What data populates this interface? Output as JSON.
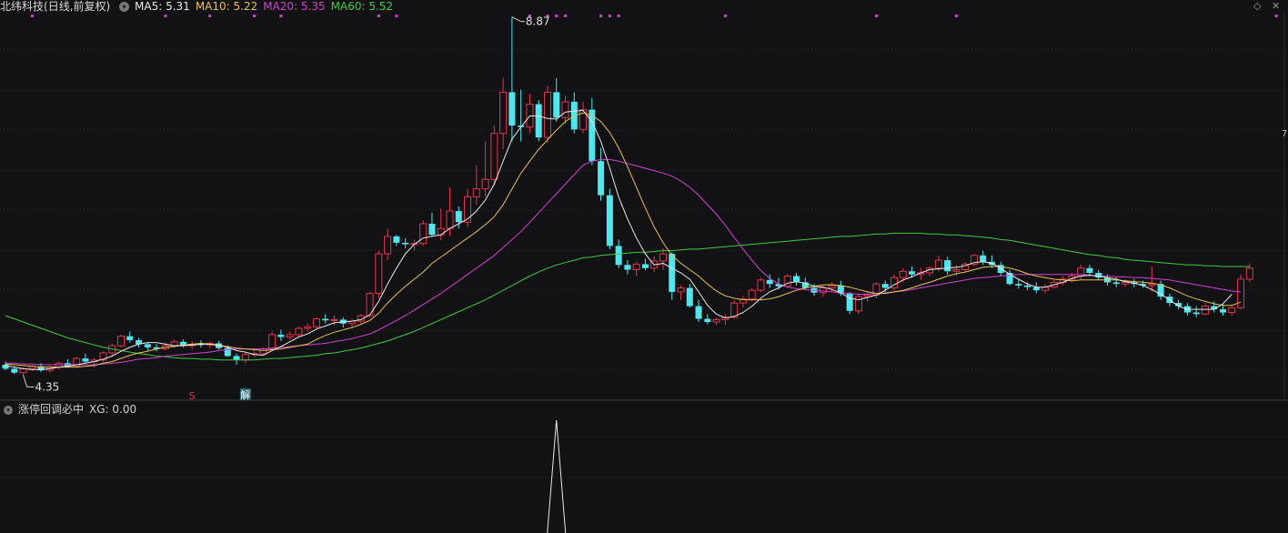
{
  "main_header": {
    "stock_name": "北纬科技",
    "period": "(日线,前复权)",
    "toggle_glyph": "▾",
    "ma": [
      {
        "label": "MA5: 5.31",
        "color": "#e8e8e8"
      },
      {
        "label": "MA10: 5.22",
        "color": "#e8c24a"
      },
      {
        "label": "MA20: 5.35",
        "color": "#d43fd4"
      },
      {
        "label": "MA60: 5.52",
        "color": "#3ecb3e"
      }
    ]
  },
  "sub_header": {
    "indicator": "涨停回调必中",
    "value": "XG: 0.00",
    "toggle_glyph": "▾"
  },
  "annotations": {
    "high_label": "8.87",
    "low_label": "4.35",
    "marker_s": "S",
    "marker_jie": "解",
    "edge_mark": "7"
  },
  "icons": {
    "diamond": "◇",
    "close": "✕"
  },
  "colors": {
    "bg": "#121215",
    "up": "#e8334a",
    "down": "#4ce8f0",
    "grid": "#2a2a30",
    "divider": "#3a3a40",
    "ma5": "#e8e8e8",
    "ma10": "#e8c24a",
    "ma20": "#d43fd4",
    "ma60": "#3ecb3e",
    "signal": "#d43fd4",
    "xg": "#e8e8e8"
  },
  "chart_data": {
    "type": "candlestick",
    "ohlc": [
      [
        4.48,
        4.52,
        4.41,
        4.43
      ],
      [
        4.43,
        4.46,
        4.36,
        4.38
      ],
      [
        4.38,
        4.45,
        4.35,
        4.43
      ],
      [
        4.43,
        4.48,
        4.4,
        4.46
      ],
      [
        4.46,
        4.5,
        4.39,
        4.41
      ],
      [
        4.41,
        4.47,
        4.38,
        4.45
      ],
      [
        4.45,
        4.52,
        4.42,
        4.5
      ],
      [
        4.5,
        4.55,
        4.44,
        4.46
      ],
      [
        4.46,
        4.58,
        4.44,
        4.56
      ],
      [
        4.56,
        4.62,
        4.5,
        4.52
      ],
      [
        4.52,
        4.56,
        4.45,
        4.54
      ],
      [
        4.54,
        4.65,
        4.52,
        4.63
      ],
      [
        4.63,
        4.75,
        4.6,
        4.72
      ],
      [
        4.72,
        4.86,
        4.7,
        4.84
      ],
      [
        4.84,
        4.9,
        4.76,
        4.79
      ],
      [
        4.79,
        4.82,
        4.7,
        4.74
      ],
      [
        4.74,
        4.76,
        4.66,
        4.7
      ],
      [
        4.7,
        4.74,
        4.65,
        4.68
      ],
      [
        4.68,
        4.76,
        4.66,
        4.72
      ],
      [
        4.72,
        4.8,
        4.7,
        4.77
      ],
      [
        4.77,
        4.8,
        4.7,
        4.72
      ],
      [
        4.72,
        4.78,
        4.68,
        4.74
      ],
      [
        4.74,
        4.79,
        4.7,
        4.73
      ],
      [
        4.73,
        4.77,
        4.69,
        4.75
      ],
      [
        4.75,
        4.78,
        4.67,
        4.69
      ],
      [
        4.69,
        4.72,
        4.58,
        4.59
      ],
      [
        4.59,
        4.62,
        4.48,
        4.54
      ],
      [
        4.54,
        4.63,
        4.5,
        4.61
      ],
      [
        4.61,
        4.66,
        4.58,
        4.62
      ],
      [
        4.62,
        4.7,
        4.6,
        4.68
      ],
      [
        4.68,
        4.9,
        4.66,
        4.86
      ],
      [
        4.86,
        4.92,
        4.78,
        4.83
      ],
      [
        4.83,
        4.9,
        4.8,
        4.86
      ],
      [
        4.86,
        4.96,
        4.84,
        4.94
      ],
      [
        4.94,
        5.0,
        4.9,
        4.96
      ],
      [
        4.96,
        5.08,
        4.94,
        5.06
      ],
      [
        5.06,
        5.12,
        5.0,
        5.04
      ],
      [
        5.04,
        5.1,
        4.98,
        5.05
      ],
      [
        5.05,
        5.08,
        4.95,
        5.0
      ],
      [
        5.0,
        5.06,
        4.96,
        5.03
      ],
      [
        5.03,
        5.12,
        5.0,
        5.1
      ],
      [
        5.1,
        5.4,
        5.08,
        5.38
      ],
      [
        5.38,
        5.92,
        5.32,
        5.88
      ],
      [
        5.88,
        6.2,
        5.8,
        6.1
      ],
      [
        6.1,
        6.12,
        5.98,
        6.02
      ],
      [
        6.02,
        6.08,
        5.95,
        6.0
      ],
      [
        6.0,
        6.06,
        5.92,
        6.01
      ],
      [
        6.01,
        6.3,
        5.98,
        6.26
      ],
      [
        6.26,
        6.4,
        6.1,
        6.12
      ],
      [
        6.12,
        6.45,
        6.05,
        6.2
      ],
      [
        6.2,
        6.72,
        6.1,
        6.42
      ],
      [
        6.42,
        6.48,
        6.2,
        6.28
      ],
      [
        6.28,
        6.7,
        6.22,
        6.6
      ],
      [
        6.6,
        7.0,
        6.5,
        6.7
      ],
      [
        6.7,
        7.3,
        6.6,
        6.82
      ],
      [
        6.82,
        7.5,
        6.75,
        7.4
      ],
      [
        7.4,
        8.1,
        7.2,
        7.92
      ],
      [
        7.92,
        8.87,
        7.3,
        7.5
      ],
      [
        7.5,
        7.95,
        7.3,
        7.48
      ],
      [
        7.48,
        7.9,
        7.4,
        7.77
      ],
      [
        7.77,
        7.82,
        7.3,
        7.35
      ],
      [
        7.35,
        8.0,
        7.28,
        7.92
      ],
      [
        7.92,
        8.1,
        7.55,
        7.6
      ],
      [
        7.6,
        7.88,
        7.52,
        7.8
      ],
      [
        7.8,
        7.92,
        7.4,
        7.45
      ],
      [
        7.45,
        7.8,
        7.4,
        7.7
      ],
      [
        7.7,
        7.85,
        7.0,
        7.05
      ],
      [
        7.05,
        7.22,
        6.55,
        6.62
      ],
      [
        6.62,
        6.7,
        5.94,
        5.98
      ],
      [
        5.98,
        6.06,
        5.7,
        5.74
      ],
      [
        5.74,
        5.8,
        5.62,
        5.68
      ],
      [
        5.68,
        5.78,
        5.6,
        5.75
      ],
      [
        5.75,
        5.82,
        5.67,
        5.7
      ],
      [
        5.7,
        5.85,
        5.65,
        5.79
      ],
      [
        5.79,
        5.95,
        5.68,
        5.88
      ],
      [
        5.88,
        5.9,
        5.3,
        5.4
      ],
      [
        5.4,
        5.48,
        5.3,
        5.45
      ],
      [
        5.45,
        5.5,
        5.2,
        5.22
      ],
      [
        5.22,
        5.3,
        5.02,
        5.06
      ],
      [
        5.06,
        5.12,
        4.99,
        5.02
      ],
      [
        5.02,
        5.07,
        4.98,
        5.05
      ],
      [
        5.05,
        5.12,
        4.98,
        5.08
      ],
      [
        5.08,
        5.3,
        5.06,
        5.26
      ],
      [
        5.26,
        5.35,
        5.2,
        5.31
      ],
      [
        5.31,
        5.45,
        5.28,
        5.42
      ],
      [
        5.42,
        5.58,
        5.4,
        5.55
      ],
      [
        5.55,
        5.62,
        5.45,
        5.5
      ],
      [
        5.5,
        5.58,
        5.43,
        5.47
      ],
      [
        5.47,
        5.62,
        5.45,
        5.6
      ],
      [
        5.6,
        5.64,
        5.48,
        5.52
      ],
      [
        5.52,
        5.58,
        5.42,
        5.45
      ],
      [
        5.45,
        5.5,
        5.35,
        5.39
      ],
      [
        5.39,
        5.48,
        5.34,
        5.45
      ],
      [
        5.45,
        5.52,
        5.4,
        5.48
      ],
      [
        5.48,
        5.54,
        5.35,
        5.38
      ],
      [
        5.38,
        5.4,
        5.12,
        5.16
      ],
      [
        5.16,
        5.38,
        5.12,
        5.34
      ],
      [
        5.34,
        5.4,
        5.28,
        5.36
      ],
      [
        5.36,
        5.52,
        5.32,
        5.5
      ],
      [
        5.5,
        5.54,
        5.4,
        5.45
      ],
      [
        5.45,
        5.62,
        5.42,
        5.58
      ],
      [
        5.58,
        5.7,
        5.52,
        5.66
      ],
      [
        5.66,
        5.72,
        5.58,
        5.62
      ],
      [
        5.62,
        5.7,
        5.55,
        5.64
      ],
      [
        5.64,
        5.72,
        5.6,
        5.7
      ],
      [
        5.7,
        5.86,
        5.66,
        5.8
      ],
      [
        5.8,
        5.84,
        5.62,
        5.66
      ],
      [
        5.66,
        5.74,
        5.6,
        5.68
      ],
      [
        5.68,
        5.78,
        5.65,
        5.75
      ],
      [
        5.75,
        5.88,
        5.72,
        5.86
      ],
      [
        5.86,
        5.92,
        5.74,
        5.78
      ],
      [
        5.78,
        5.86,
        5.7,
        5.74
      ],
      [
        5.74,
        5.78,
        5.6,
        5.64
      ],
      [
        5.64,
        5.68,
        5.48,
        5.5
      ],
      [
        5.5,
        5.56,
        5.44,
        5.48
      ],
      [
        5.48,
        5.52,
        5.42,
        5.46
      ],
      [
        5.46,
        5.52,
        5.38,
        5.42
      ],
      [
        5.42,
        5.5,
        5.38,
        5.46
      ],
      [
        5.46,
        5.56,
        5.44,
        5.52
      ],
      [
        5.52,
        5.6,
        5.48,
        5.56
      ],
      [
        5.56,
        5.64,
        5.52,
        5.6
      ],
      [
        5.6,
        5.74,
        5.56,
        5.7
      ],
      [
        5.7,
        5.74,
        5.6,
        5.64
      ],
      [
        5.64,
        5.68,
        5.55,
        5.58
      ],
      [
        5.58,
        5.62,
        5.48,
        5.52
      ],
      [
        5.52,
        5.58,
        5.46,
        5.5
      ],
      [
        5.5,
        5.56,
        5.46,
        5.52
      ],
      [
        5.52,
        5.56,
        5.46,
        5.5
      ],
      [
        5.5,
        5.54,
        5.45,
        5.48
      ],
      [
        5.48,
        5.72,
        5.4,
        5.5
      ],
      [
        5.5,
        5.54,
        5.3,
        5.34
      ],
      [
        5.34,
        5.38,
        5.22,
        5.26
      ],
      [
        5.26,
        5.3,
        5.18,
        5.22
      ],
      [
        5.22,
        5.26,
        5.1,
        5.14
      ],
      [
        5.14,
        5.22,
        5.08,
        5.12
      ],
      [
        5.12,
        5.26,
        5.1,
        5.22
      ],
      [
        5.22,
        5.28,
        5.14,
        5.18
      ],
      [
        5.18,
        5.24,
        5.1,
        5.14
      ],
      [
        5.14,
        5.22,
        5.1,
        5.2
      ],
      [
        5.2,
        5.62,
        5.18,
        5.56
      ],
      [
        5.56,
        5.76,
        5.52,
        5.7
      ]
    ],
    "ma5": [
      4.47,
      4.45,
      4.43,
      4.42,
      4.42,
      4.43,
      4.45,
      4.46,
      4.48,
      4.5,
      4.52,
      4.55,
      4.59,
      4.65,
      4.7,
      4.74,
      4.76,
      4.76,
      4.74,
      4.72,
      4.72,
      4.73,
      4.74,
      4.74,
      4.73,
      4.7,
      4.66,
      4.64,
      4.61,
      4.6,
      4.66,
      4.71,
      4.77,
      4.83,
      4.87,
      4.93,
      4.97,
      5.01,
      5.02,
      5.03,
      5.05,
      5.11,
      5.28,
      5.5,
      5.7,
      5.88,
      6.0,
      6.08,
      6.1,
      6.12,
      6.2,
      6.26,
      6.32,
      6.42,
      6.56,
      6.76,
      7.05,
      7.33,
      7.48,
      7.62,
      7.62,
      7.59,
      7.58,
      7.67,
      7.68,
      7.69,
      7.55,
      7.3,
      6.96,
      6.6,
      6.32,
      6.08,
      5.88,
      5.74,
      5.76,
      5.7,
      5.64,
      5.56,
      5.4,
      5.23,
      5.12,
      5.07,
      5.09,
      5.14,
      5.22,
      5.32,
      5.4,
      5.45,
      5.51,
      5.53,
      5.51,
      5.47,
      5.46,
      5.43,
      5.39,
      5.32,
      5.3,
      5.33,
      5.36,
      5.42,
      5.49,
      5.55,
      5.59,
      5.64,
      5.68,
      5.69,
      5.7,
      5.71,
      5.73,
      5.77,
      5.78,
      5.76,
      5.7,
      5.62,
      5.56,
      5.5,
      5.46,
      5.46,
      5.49,
      5.52,
      5.57,
      5.6,
      5.61,
      5.6,
      5.58,
      5.56,
      5.53,
      5.51,
      5.48,
      5.43,
      5.37,
      5.3,
      5.22,
      5.18,
      5.18,
      5.18,
      5.18,
      5.25,
      5.37
    ],
    "ma10": [
      4.49,
      4.48,
      4.47,
      4.46,
      4.45,
      4.45,
      4.45,
      4.45,
      4.45,
      4.46,
      4.47,
      4.5,
      4.52,
      4.56,
      4.6,
      4.63,
      4.65,
      4.68,
      4.7,
      4.71,
      4.73,
      4.74,
      4.75,
      4.74,
      4.72,
      4.71,
      4.69,
      4.68,
      4.67,
      4.66,
      4.67,
      4.68,
      4.7,
      4.72,
      4.74,
      4.8,
      4.85,
      4.89,
      4.92,
      4.95,
      4.99,
      5.04,
      5.13,
      5.26,
      5.37,
      5.47,
      5.56,
      5.65,
      5.76,
      5.84,
      5.92,
      6.0,
      6.08,
      6.16,
      6.25,
      6.35,
      6.5,
      6.7,
      6.9,
      7.05,
      7.2,
      7.32,
      7.44,
      7.55,
      7.62,
      7.66,
      7.63,
      7.55,
      7.41,
      7.22,
      6.98,
      6.72,
      6.46,
      6.22,
      6.02,
      5.86,
      5.76,
      5.68,
      5.6,
      5.5,
      5.41,
      5.35,
      5.32,
      5.3,
      5.3,
      5.3,
      5.31,
      5.34,
      5.38,
      5.42,
      5.45,
      5.47,
      5.49,
      5.49,
      5.48,
      5.46,
      5.43,
      5.4,
      5.38,
      5.38,
      5.4,
      5.42,
      5.45,
      5.49,
      5.52,
      5.56,
      5.6,
      5.63,
      5.65,
      5.68,
      5.71,
      5.72,
      5.72,
      5.7,
      5.67,
      5.63,
      5.6,
      5.58,
      5.56,
      5.55,
      5.54,
      5.55,
      5.55,
      5.55,
      5.55,
      5.55,
      5.54,
      5.53,
      5.52,
      5.51,
      5.49,
      5.45,
      5.4,
      5.35,
      5.31,
      5.28,
      5.25,
      5.23,
      5.23,
      5.27
    ],
    "ma20": [
      4.5,
      4.5,
      4.49,
      4.49,
      4.48,
      4.48,
      4.48,
      4.48,
      4.48,
      4.48,
      4.48,
      4.49,
      4.5,
      4.51,
      4.53,
      4.55,
      4.56,
      4.57,
      4.59,
      4.6,
      4.61,
      4.62,
      4.63,
      4.64,
      4.66,
      4.67,
      4.68,
      4.68,
      4.68,
      4.68,
      4.69,
      4.7,
      4.71,
      4.72,
      4.73,
      4.74,
      4.75,
      4.77,
      4.79,
      4.81,
      4.84,
      4.87,
      4.92,
      4.98,
      5.04,
      5.1,
      5.17,
      5.24,
      5.31,
      5.38,
      5.46,
      5.54,
      5.62,
      5.7,
      5.78,
      5.86,
      5.96,
      6.06,
      6.16,
      6.28,
      6.4,
      6.52,
      6.64,
      6.76,
      6.88,
      7.0,
      7.05,
      7.07,
      7.07,
      7.05,
      7.02,
      6.99,
      6.96,
      6.93,
      6.9,
      6.86,
      6.8,
      6.72,
      6.62,
      6.5,
      6.38,
      6.24,
      6.09,
      5.94,
      5.8,
      5.67,
      5.57,
      5.5,
      5.46,
      5.44,
      5.43,
      5.42,
      5.41,
      5.4,
      5.39,
      5.38,
      5.37,
      5.37,
      5.38,
      5.39,
      5.4,
      5.41,
      5.43,
      5.45,
      5.47,
      5.49,
      5.51,
      5.53,
      5.55,
      5.57,
      5.58,
      5.59,
      5.6,
      5.61,
      5.62,
      5.62,
      5.62,
      5.62,
      5.62,
      5.62,
      5.62,
      5.62,
      5.61,
      5.6,
      5.6,
      5.59,
      5.59,
      5.58,
      5.58,
      5.57,
      5.56,
      5.55,
      5.53,
      5.51,
      5.49,
      5.47,
      5.45,
      5.43,
      5.41,
      5.4
    ],
    "ma60": [
      5.1,
      5.06,
      5.02,
      4.98,
      4.94,
      4.9,
      4.86,
      4.82,
      4.79,
      4.76,
      4.73,
      4.7,
      4.68,
      4.66,
      4.64,
      4.62,
      4.61,
      4.59,
      4.58,
      4.57,
      4.56,
      4.56,
      4.55,
      4.55,
      4.54,
      4.54,
      4.54,
      4.54,
      4.54,
      4.55,
      4.56,
      4.56,
      4.57,
      4.58,
      4.59,
      4.6,
      4.62,
      4.63,
      4.65,
      4.67,
      4.69,
      4.72,
      4.75,
      4.78,
      4.82,
      4.86,
      4.9,
      4.95,
      5.0,
      5.05,
      5.1,
      5.15,
      5.2,
      5.25,
      5.3,
      5.36,
      5.42,
      5.48,
      5.54,
      5.6,
      5.65,
      5.7,
      5.74,
      5.77,
      5.8,
      5.83,
      5.84,
      5.86,
      5.87,
      5.88,
      5.89,
      5.9,
      5.9,
      5.91,
      5.92,
      5.92,
      5.93,
      5.94,
      5.94,
      5.95,
      5.96,
      5.97,
      5.98,
      5.99,
      6.0,
      6.01,
      6.02,
      6.03,
      6.04,
      6.05,
      6.06,
      6.07,
      6.08,
      6.09,
      6.1,
      6.1,
      6.11,
      6.12,
      6.13,
      6.13,
      6.14,
      6.14,
      6.14,
      6.14,
      6.13,
      6.13,
      6.12,
      6.12,
      6.11,
      6.1,
      6.09,
      6.08,
      6.06,
      6.05,
      6.03,
      6.01,
      5.99,
      5.97,
      5.95,
      5.93,
      5.91,
      5.89,
      5.87,
      5.86,
      5.84,
      5.83,
      5.81,
      5.8,
      5.79,
      5.78,
      5.77,
      5.76,
      5.75,
      5.74,
      5.74,
      5.73,
      5.73,
      5.72,
      5.72,
      5.72,
      5.72
    ],
    "signal_days": [
      3,
      18,
      23,
      28,
      31,
      42,
      44,
      59,
      61,
      62,
      63,
      67,
      68,
      69,
      81,
      98,
      107,
      143,
      145
    ],
    "xg": {
      "peak_index": 62,
      "peak_value": 1.0
    },
    "high": {
      "index": 57,
      "value": 8.87
    },
    "low": {
      "index": 2,
      "value": 4.35
    },
    "markers": [
      {
        "index": 21,
        "type": "S"
      },
      {
        "index": 27,
        "type": "解"
      }
    ]
  }
}
